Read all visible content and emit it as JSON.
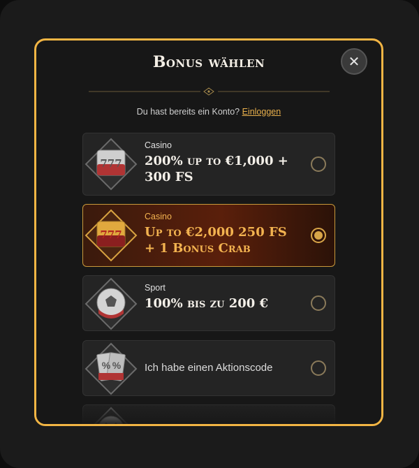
{
  "modal": {
    "title": "Bonus wählen",
    "close_icon": "close-icon",
    "login_prompt": "Du hast bereits ein Konto?",
    "login_link": "Einloggen"
  },
  "options": [
    {
      "category": "Casino",
      "offer": "200% up to €1,000 + 300 FS",
      "icon": "slot-777-icon",
      "selected": false
    },
    {
      "category": "Casino",
      "offer": "Up to €2,000 250 FS + 1 Bonus Crab",
      "icon": "slot-777-gold-icon",
      "selected": true
    },
    {
      "category": "Sport",
      "offer": "100% bis zu 200 €",
      "icon": "soccer-ball-icon",
      "selected": false
    },
    {
      "category": "",
      "offer": "Ich habe einen Aktionscode",
      "icon": "percent-cards-icon",
      "selected": false
    },
    {
      "category": "",
      "offer": "",
      "icon": "no-bonus-icon",
      "selected": false
    }
  ],
  "colors": {
    "accent": "#f2b544",
    "selected_text": "#f3b350"
  }
}
